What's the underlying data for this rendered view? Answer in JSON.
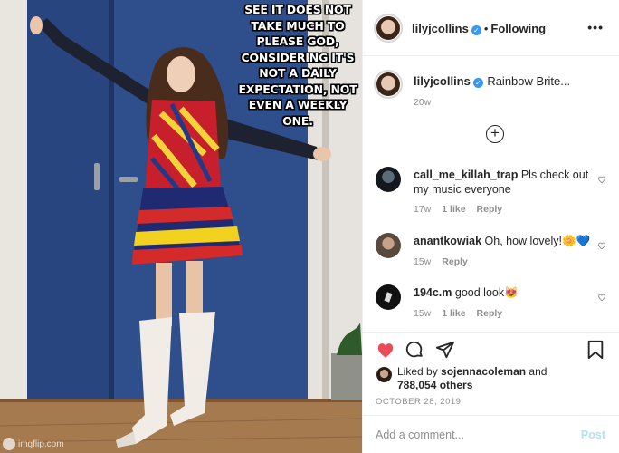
{
  "meme": {
    "caption": "SEE IT DOES NOT TAKE MUCH TO PLEASE GOD, CONSIDERING IT'S NOT A DAILY EXPECTATION, NOT EVEN A WEEKLY ONE.",
    "watermark": "imgflip.com"
  },
  "post": {
    "username": "lilyjcollins",
    "separator": "•",
    "follow_status": "Following",
    "more_icon": "•••",
    "caption": {
      "username": "lilyjcollins",
      "text": "Rainbow Brite...",
      "age": "20w"
    },
    "load_more_icon": "⊕",
    "comments": [
      {
        "username": "call_me_killah_trap",
        "text": "Pls check out my music everyone",
        "age": "17w",
        "likes": "1 like",
        "reply": "Reply"
      },
      {
        "username": "anantkowiak",
        "text": "Oh, how lovely!🌼💙",
        "age": "15w",
        "likes": "",
        "reply": "Reply"
      },
      {
        "username": "194c.m",
        "text": "good look😻",
        "age": "15w",
        "likes": "1 like",
        "reply": "Reply"
      }
    ],
    "liked_by_prefix": "Liked by",
    "liked_by_user": "sojennacoleman",
    "liked_by_and": "and",
    "liked_count": "788,054 others",
    "date": "OCTOBER 28, 2019",
    "add_comment_placeholder": "Add a comment...",
    "post_button": "Post"
  },
  "colors": {
    "verified": "#3897f0",
    "like_heart": "#ed4956",
    "post_button_disabled": "#b2dffc",
    "meta_gray": "#8e8e8e"
  }
}
